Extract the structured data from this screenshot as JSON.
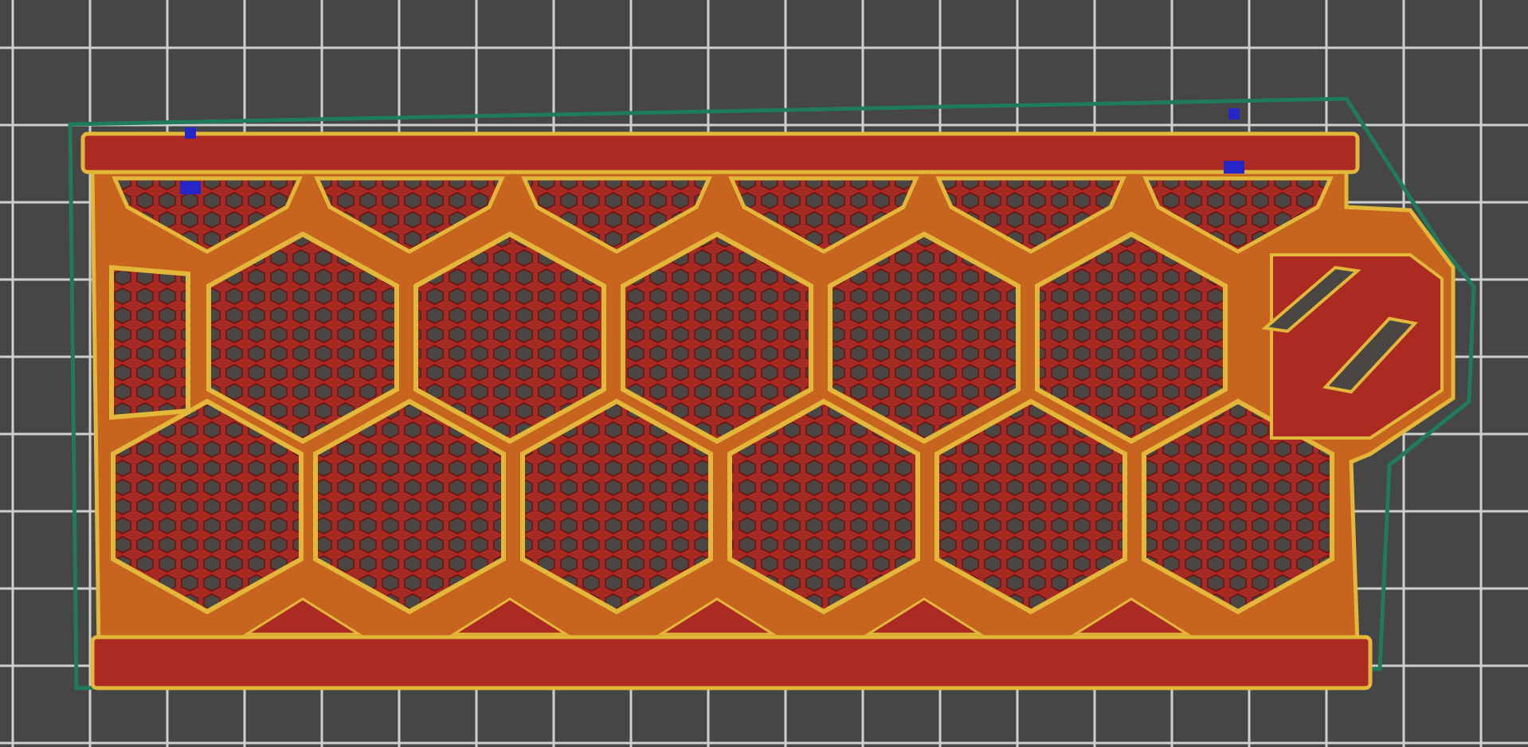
{
  "canvas": {
    "kind": "layer-preview"
  }
}
